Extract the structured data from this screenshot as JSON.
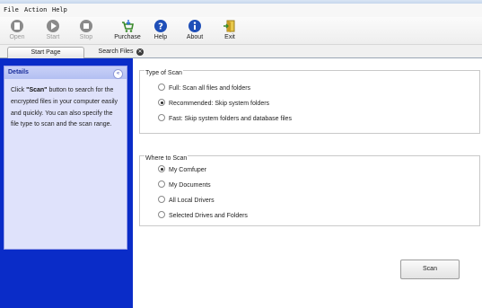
{
  "menu": [
    "File",
    "Action",
    "Help"
  ],
  "toolbar": [
    {
      "label": "Open",
      "icon": "open-icon",
      "enabled": false
    },
    {
      "label": "Start",
      "icon": "start-icon",
      "enabled": false
    },
    {
      "label": "Stop",
      "icon": "stop-icon",
      "enabled": false
    },
    {
      "label": "Purchase",
      "icon": "cart-icon",
      "enabled": true
    },
    {
      "label": "Help",
      "icon": "help-icon",
      "enabled": true
    },
    {
      "label": "About",
      "icon": "info-icon",
      "enabled": true
    },
    {
      "label": "Exit",
      "icon": "exit-icon",
      "enabled": true
    }
  ],
  "tabs": {
    "start": "Start Page",
    "search": "Search Files"
  },
  "details": {
    "title": "Details",
    "pre": "Click ",
    "keyword": "\"Scan\"",
    "post": " button to search for the encrypted files in your computer easily and quickly. You can also specify the file type to scan and the scan range."
  },
  "type_of_scan": {
    "title": "Type of Scan",
    "options": [
      {
        "label": "Full: Scan all files and folders",
        "selected": false
      },
      {
        "label": "Recommended: Skip system folders",
        "selected": true
      },
      {
        "label": "Fast: Skip system folders and database files",
        "selected": false
      }
    ]
  },
  "where_to_scan": {
    "title": "Where to Scan",
    "options": [
      {
        "label": "My Comfuper",
        "selected": true
      },
      {
        "label": "My Documents",
        "selected": false
      },
      {
        "label": "All Local Drivers",
        "selected": false
      },
      {
        "label": "Selected Drives and Folders",
        "selected": false
      }
    ]
  },
  "scan_button": "Scan",
  "colors": {
    "sidebar": "#0a2cc8",
    "panel": "#dfe2fb",
    "panel_title": "#1a2e9c"
  }
}
